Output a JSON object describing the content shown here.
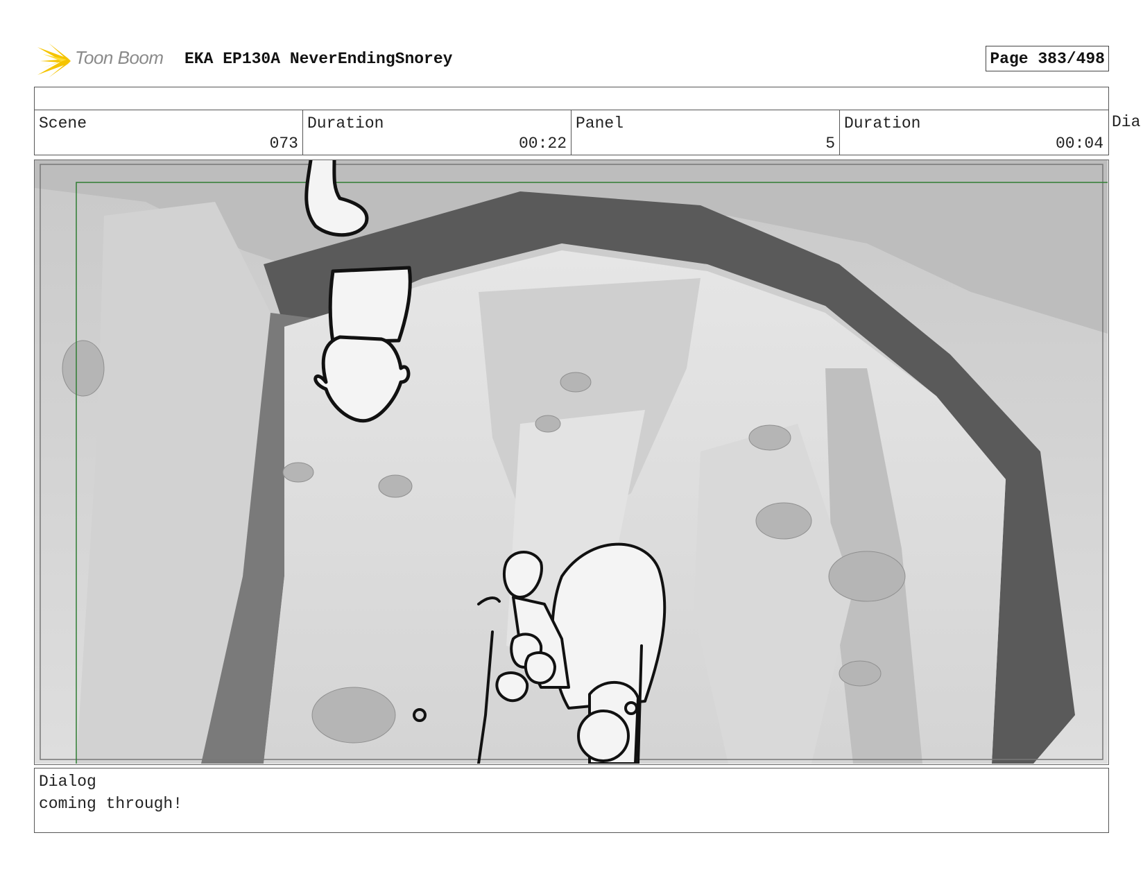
{
  "header": {
    "logo_text": "Toon Boom",
    "title": "EKA EP130A NeverEndingSnorey",
    "page_label": "Page 383/498"
  },
  "info": {
    "scene_label": "Scene",
    "scene_value": "073",
    "scene_duration_label": "Duration",
    "scene_duration_value": "00:22",
    "panel_label": "Panel",
    "panel_value": "5",
    "panel_duration_label": "Duration",
    "panel_duration_value": "00:04",
    "overflow_label": "Dia"
  },
  "dialog": {
    "label": "Dialog",
    "text": "coming through!"
  },
  "colors": {
    "logo_star": "#f5c400",
    "border": "#555555",
    "safe_area": "#2e7d32"
  }
}
